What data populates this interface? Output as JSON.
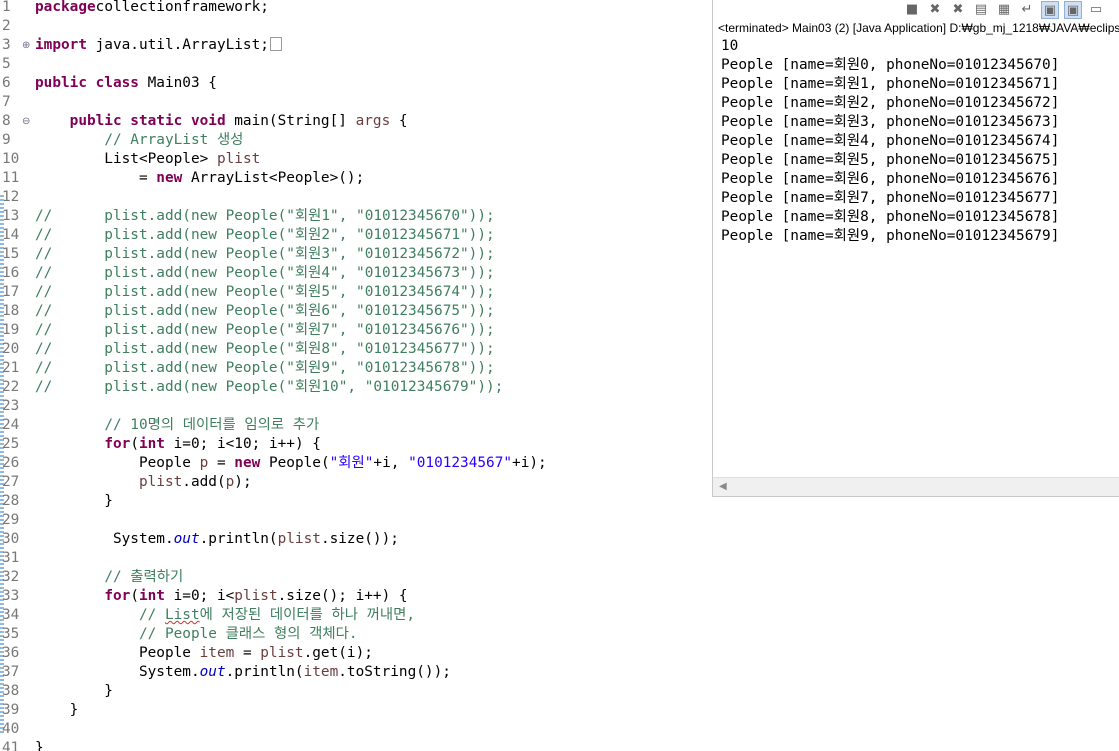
{
  "editor": {
    "lines": [
      {
        "n": "1",
        "segs": [
          [
            "kw",
            "package"
          ],
          [
            "",
            "collectionframework;"
          ]
        ]
      },
      {
        "n": "2",
        "segs": []
      },
      {
        "n": "3",
        "fold": "⊕",
        "segs": [
          [
            "kw",
            "import"
          ],
          [
            "",
            " java.util.ArrayList;"
          ]
        ],
        "collapsed": true
      },
      {
        "n": "5",
        "segs": []
      },
      {
        "n": "6",
        "segs": [
          [
            "kw",
            "public class"
          ],
          [
            "",
            " Main03 {"
          ]
        ]
      },
      {
        "n": "7",
        "segs": []
      },
      {
        "n": "8",
        "fold": "⊖",
        "segs": [
          [
            "",
            "    "
          ],
          [
            "kw",
            "public static void"
          ],
          [
            "",
            " main(String[] "
          ],
          [
            "lv",
            "args"
          ],
          [
            "",
            " {"
          ]
        ]
      },
      {
        "n": "9",
        "segs": [
          [
            "",
            "        "
          ],
          [
            "cm",
            "// ArrayList 생성"
          ]
        ]
      },
      {
        "n": "10",
        "segs": [
          [
            "",
            "        List<People> "
          ],
          [
            "lv",
            "plist"
          ]
        ]
      },
      {
        "n": "11",
        "segs": [
          [
            "",
            "            = "
          ],
          [
            "kw",
            "new"
          ],
          [
            "",
            " ArrayList<People>();"
          ]
        ]
      },
      {
        "n": "12",
        "segs": []
      },
      {
        "n": "13",
        "segs": [
          [
            "cm",
            "//      plist.add(new People(\"회원1\", \"01012345670\"));"
          ]
        ]
      },
      {
        "n": "14",
        "segs": [
          [
            "cm",
            "//      plist.add(new People(\"회원2\", \"01012345671\"));"
          ]
        ]
      },
      {
        "n": "15",
        "segs": [
          [
            "cm",
            "//      plist.add(new People(\"회원3\", \"01012345672\"));"
          ]
        ]
      },
      {
        "n": "16",
        "segs": [
          [
            "cm",
            "//      plist.add(new People(\"회원4\", \"01012345673\"));"
          ]
        ]
      },
      {
        "n": "17",
        "segs": [
          [
            "cm",
            "//      plist.add(new People(\"회원5\", \"01012345674\"));"
          ]
        ]
      },
      {
        "n": "18",
        "segs": [
          [
            "cm",
            "//      plist.add(new People(\"회원6\", \"01012345675\"));"
          ]
        ]
      },
      {
        "n": "19",
        "segs": [
          [
            "cm",
            "//      plist.add(new People(\"회원7\", \"01012345676\"));"
          ]
        ]
      },
      {
        "n": "20",
        "segs": [
          [
            "cm",
            "//      plist.add(new People(\"회원8\", \"01012345677\"));"
          ]
        ]
      },
      {
        "n": "21",
        "segs": [
          [
            "cm",
            "//      plist.add(new People(\"회원9\", \"01012345678\"));"
          ]
        ]
      },
      {
        "n": "22",
        "segs": [
          [
            "cm",
            "//      plist.add(new People(\"회원10\", \"01012345679\"));"
          ]
        ]
      },
      {
        "n": "23",
        "segs": []
      },
      {
        "n": "24",
        "segs": [
          [
            "",
            "        "
          ],
          [
            "cm",
            "// 10명의 데이터를 임의로 추가"
          ]
        ]
      },
      {
        "n": "25",
        "segs": [
          [
            "",
            "        "
          ],
          [
            "kw",
            "for"
          ],
          [
            "",
            "("
          ],
          [
            "kw",
            "int"
          ],
          [
            "",
            " i=0; i<10; i++) {"
          ]
        ]
      },
      {
        "n": "26",
        "segs": [
          [
            "",
            "            People "
          ],
          [
            "lv",
            "p"
          ],
          [
            "",
            " = "
          ],
          [
            "kw",
            "new"
          ],
          [
            "",
            " People("
          ],
          [
            "str",
            "\"회원\""
          ],
          [
            "",
            "+i, "
          ],
          [
            "str",
            "\"0101234567\""
          ],
          [
            "",
            "+i);"
          ]
        ]
      },
      {
        "n": "27",
        "segs": [
          [
            "",
            "            "
          ],
          [
            "lv",
            "plist"
          ],
          [
            "",
            ".add("
          ],
          [
            "lv",
            "p"
          ],
          [
            "",
            ");"
          ]
        ]
      },
      {
        "n": "28",
        "segs": [
          [
            "",
            "        }"
          ]
        ]
      },
      {
        "n": "29",
        "segs": []
      },
      {
        "n": "30",
        "segs": [
          [
            "",
            "         System."
          ],
          [
            "fld",
            "out"
          ],
          [
            "",
            ".println("
          ],
          [
            "lv",
            "plist"
          ],
          [
            "",
            ".size());"
          ]
        ]
      },
      {
        "n": "31",
        "segs": []
      },
      {
        "n": "32",
        "segs": [
          [
            "",
            "        "
          ],
          [
            "cm",
            "// 출력하기"
          ]
        ]
      },
      {
        "n": "33",
        "segs": [
          [
            "",
            "        "
          ],
          [
            "kw",
            "for"
          ],
          [
            "",
            "("
          ],
          [
            "kw",
            "int"
          ],
          [
            "",
            " i=0; i<"
          ],
          [
            "lv",
            "plist"
          ],
          [
            "",
            ".size(); i++) {"
          ]
        ]
      },
      {
        "n": "34",
        "segs": [
          [
            "",
            "            "
          ],
          [
            "cm",
            "// "
          ],
          [
            "cm squig",
            "List"
          ],
          [
            "cm",
            "에 저장된 데이터를 하나 꺼내면,"
          ]
        ]
      },
      {
        "n": "35",
        "segs": [
          [
            "",
            "            "
          ],
          [
            "cm",
            "// People 클래스 형의 객체다."
          ]
        ]
      },
      {
        "n": "36",
        "segs": [
          [
            "",
            "            People "
          ],
          [
            "lv",
            "item"
          ],
          [
            "",
            " = "
          ],
          [
            "lv",
            "plist"
          ],
          [
            "",
            ".get(i);"
          ]
        ]
      },
      {
        "n": "37",
        "segs": [
          [
            "",
            "            System."
          ],
          [
            "fld",
            "out"
          ],
          [
            "",
            ".println("
          ],
          [
            "lv",
            "item"
          ],
          [
            "",
            ".toString());"
          ]
        ]
      },
      {
        "n": "38",
        "segs": [
          [
            "",
            "        }"
          ]
        ]
      },
      {
        "n": "39",
        "segs": [
          [
            "",
            "    }"
          ]
        ]
      },
      {
        "n": "40",
        "segs": []
      },
      {
        "n": "41",
        "segs": [
          [
            "",
            "}"
          ]
        ]
      }
    ]
  },
  "console": {
    "status": "<terminated> Main03 (2) [Java Application] D:₩gb_mj_1218₩JAVA₩eclips",
    "output": [
      "10",
      "People [name=회원0, phoneNo=01012345670]",
      "People [name=회원1, phoneNo=01012345671]",
      "People [name=회원2, phoneNo=01012345672]",
      "People [name=회원3, phoneNo=01012345673]",
      "People [name=회원4, phoneNo=01012345674]",
      "People [name=회원5, phoneNo=01012345675]",
      "People [name=회원6, phoneNo=01012345676]",
      "People [name=회원7, phoneNo=01012345677]",
      "People [name=회원8, phoneNo=01012345678]",
      "People [name=회원9, phoneNo=01012345679]"
    ],
    "toolbar": [
      {
        "name": "terminate-icon",
        "glyph": "■"
      },
      {
        "name": "remove-launch-icon",
        "glyph": "✖"
      },
      {
        "name": "remove-all-terminated-icon",
        "glyph": "✖"
      },
      {
        "name": "clear-console-icon",
        "glyph": "▤"
      },
      {
        "name": "scroll-lock-icon",
        "glyph": "▦"
      },
      {
        "name": "word-wrap-icon",
        "glyph": "↵"
      },
      {
        "name": "pin-console-icon",
        "glyph": "▣"
      },
      {
        "name": "display-console-icon",
        "glyph": "▣"
      },
      {
        "name": "open-console-icon",
        "glyph": "▭"
      }
    ]
  },
  "colors": {
    "keyword": "#7f0055",
    "comment": "#3f7f5f",
    "string": "#2a00ff",
    "field": "#0000c0",
    "local_var": "#6a3e3e",
    "line_number": "#787878"
  }
}
